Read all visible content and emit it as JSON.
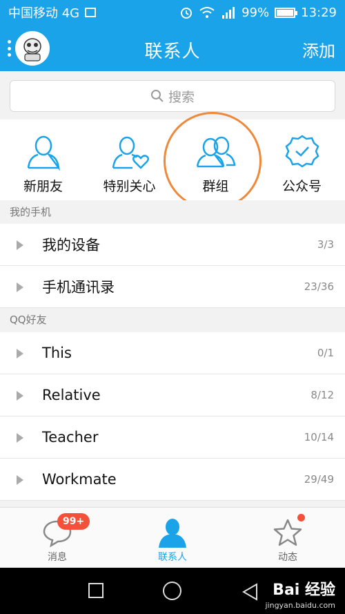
{
  "status_bar": {
    "carrier": "中国移动 4G",
    "battery": "99%",
    "battery_level": 0.99,
    "time": "13:29"
  },
  "header": {
    "title": "联系人",
    "add_label": "添加"
  },
  "search": {
    "placeholder": "搜索"
  },
  "quick_entries": [
    {
      "label": "新朋友",
      "icon": "person-icon"
    },
    {
      "label": "特别关心",
      "icon": "person-heart-icon"
    },
    {
      "label": "群组",
      "icon": "group-icon"
    },
    {
      "label": "公众号",
      "icon": "verified-badge-icon"
    }
  ],
  "sections": {
    "my_phone": {
      "header": "我的手机",
      "rows": [
        {
          "name": "我的设备",
          "count": "3/3"
        },
        {
          "name": "手机通讯录",
          "count": "23/36"
        }
      ]
    },
    "qq_friends": {
      "header": "QQ好友",
      "rows": [
        {
          "name": "This",
          "count": "0/1"
        },
        {
          "name": "Relative",
          "count": "8/12"
        },
        {
          "name": "Teacher",
          "count": "10/14"
        },
        {
          "name": "Workmate",
          "count": "29/49"
        }
      ]
    }
  },
  "tabs": [
    {
      "label": "消息",
      "badge": "99+"
    },
    {
      "label": "联系人"
    },
    {
      "label": "动态"
    }
  ],
  "watermark": {
    "brand": "Bai 经验",
    "url": "jingyan.baidu.com"
  },
  "colors": {
    "accent": "#1aa3e8",
    "badge": "#f5503a",
    "highlight_ring": "#f0883a"
  }
}
